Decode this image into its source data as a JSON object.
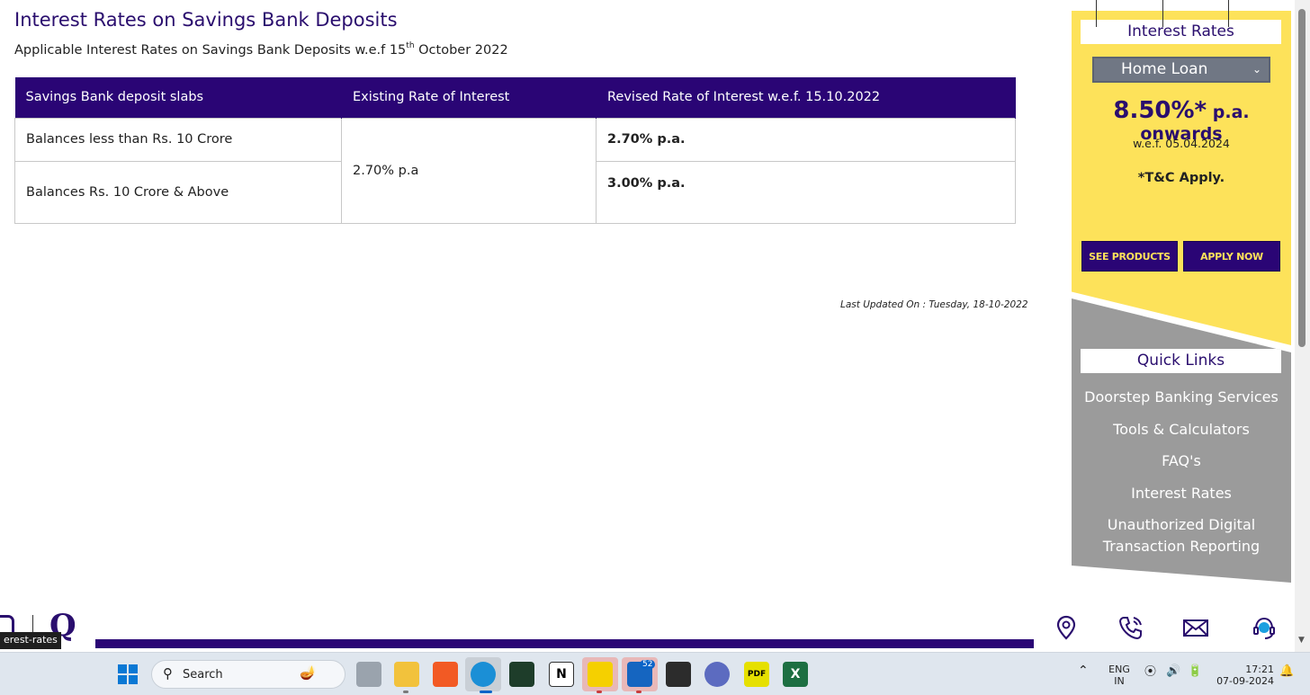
{
  "page": {
    "title": "Interest Rates on Savings Bank Deposits",
    "subtitle_pre": "Applicable Interest Rates on Savings Bank Deposits w.e.f 15",
    "subtitle_sup": "th",
    "subtitle_post": " October 2022",
    "last_updated": "Last Updated On : Tuesday, 18-10-2022"
  },
  "table": {
    "headers": [
      "Savings Bank deposit slabs",
      "Existing Rate of Interest",
      "Revised Rate of Interest w.e.f. 15.10.2022"
    ],
    "rows": [
      {
        "slab": "Balances less than Rs. 10 Crore",
        "revised": "2.70% p.a."
      },
      {
        "slab": "Balances Rs. 10 Crore & Above",
        "revised": "3.00% p.a."
      }
    ],
    "existing_merged": "2.70% p.a"
  },
  "rate_panel": {
    "heading": "Interest Rates",
    "selected_loan": "Home Loan",
    "rate": "8.50%*",
    "rate_suffix": " p.a. onwards",
    "wef": "w.e.f. 05.04.2024",
    "tc": "*T&C Apply.",
    "see_products": "SEE PRODUCTS",
    "apply_now": "APPLY NOW"
  },
  "quick_links": {
    "heading": "Quick Links",
    "items": [
      "Doorstep Banking Services",
      "Tools & Calculators",
      "FAQ's",
      "Interest Rates",
      "Unauthorized Digital",
      "Transaction Reporting"
    ]
  },
  "footer": {
    "tooltip": "erest-rates",
    "logo_letter": "Q"
  },
  "taskbar": {
    "search_label": "Search",
    "mail_badge": "52",
    "lang_top": "ENG",
    "lang_bottom": "IN",
    "time": "17:21",
    "date": "07-09-2024"
  },
  "colors": {
    "brand_purple": "#2a0575",
    "panel_yellow": "#fde25a",
    "panel_grey": "#9b9b9b"
  }
}
